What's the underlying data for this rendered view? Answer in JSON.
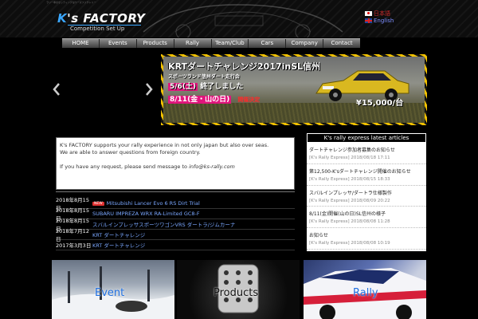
{
  "header": {
    "tagline": "ラリー車のセッティングはケーズファクトリー",
    "logo_k": "K",
    "logo_rest": "'s FACTORY",
    "logo_sub": "Competition Set Up",
    "lang_jp": "日本語",
    "lang_en": "English"
  },
  "nav": [
    "HOME",
    "Events",
    "Products",
    "Rally",
    "Team/Club",
    "Cars",
    "Company",
    "Contact"
  ],
  "banner": {
    "title": "KRTダートチャレンジ2017inSL信州",
    "subtitle": "スポーツランド信州ダート走行会",
    "date1_hl": "5/6(土)",
    "date1_rest": "終了しました",
    "date2_hl": "8/11(金・山の日)",
    "date2_red": "開催決定",
    "price": "¥15,000/台"
  },
  "info": {
    "line1": "K's FACTORY supports your rally experience in not only japan but also over seas.",
    "line2": "We are able to answer questions from foreign country.",
    "line3_prefix": "If you have any request, please send message to ",
    "email": "info@ks-rally.com"
  },
  "news": [
    {
      "date": "2018年8月15日",
      "badge": "NEW",
      "title": "Mitsubishi Lancer Evo 6 RS Dirt Trial"
    },
    {
      "date": "2018年8月15日",
      "badge": "",
      "title": "SUBARU IMPREZA WRX RA-Limited GC8-F"
    },
    {
      "date": "2018年8月15日",
      "badge": "",
      "title": "スバルインプレッサスポーツワゴンVRS ダートラ/ジムカーナ"
    },
    {
      "date": "2018年7月12日",
      "badge": "",
      "title": "KRT ダートチャレンジ"
    },
    {
      "date": "2017年3月3日",
      "badge": "",
      "title": "KRT ダートチャレンジ"
    }
  ],
  "latest": {
    "heading": "K's rally express latest articles",
    "items": [
      {
        "title": "ダートチャレンジ参加者募集のお知らせ",
        "meta": "[K's Rally Express] 2018/08/18 17:11"
      },
      {
        "title": "第12,500-K'sダートチャレンジ開催のお知らせ",
        "meta": "[K's Rally Express] 2018/08/15 18:33"
      },
      {
        "title": "スバルインプレッサ/ダートラ仕様製作",
        "meta": "[K's Rally Express] 2018/08/09 20:22"
      },
      {
        "title": "8/11(金)開催(山の日)SL信州の様子",
        "meta": "[K's Rally Express] 2018/08/08 11:28"
      },
      {
        "title": "お知らせ",
        "meta": "[K's Rally Express] 2018/08/08 10:19"
      }
    ]
  },
  "tiles": {
    "event": "Event",
    "products": "Products",
    "rally": "Rally"
  },
  "colors": {
    "accent": "#3aa7ff",
    "link": "#7aa7ff",
    "highlight": "#e0157c",
    "stripe": "#f2c200"
  }
}
